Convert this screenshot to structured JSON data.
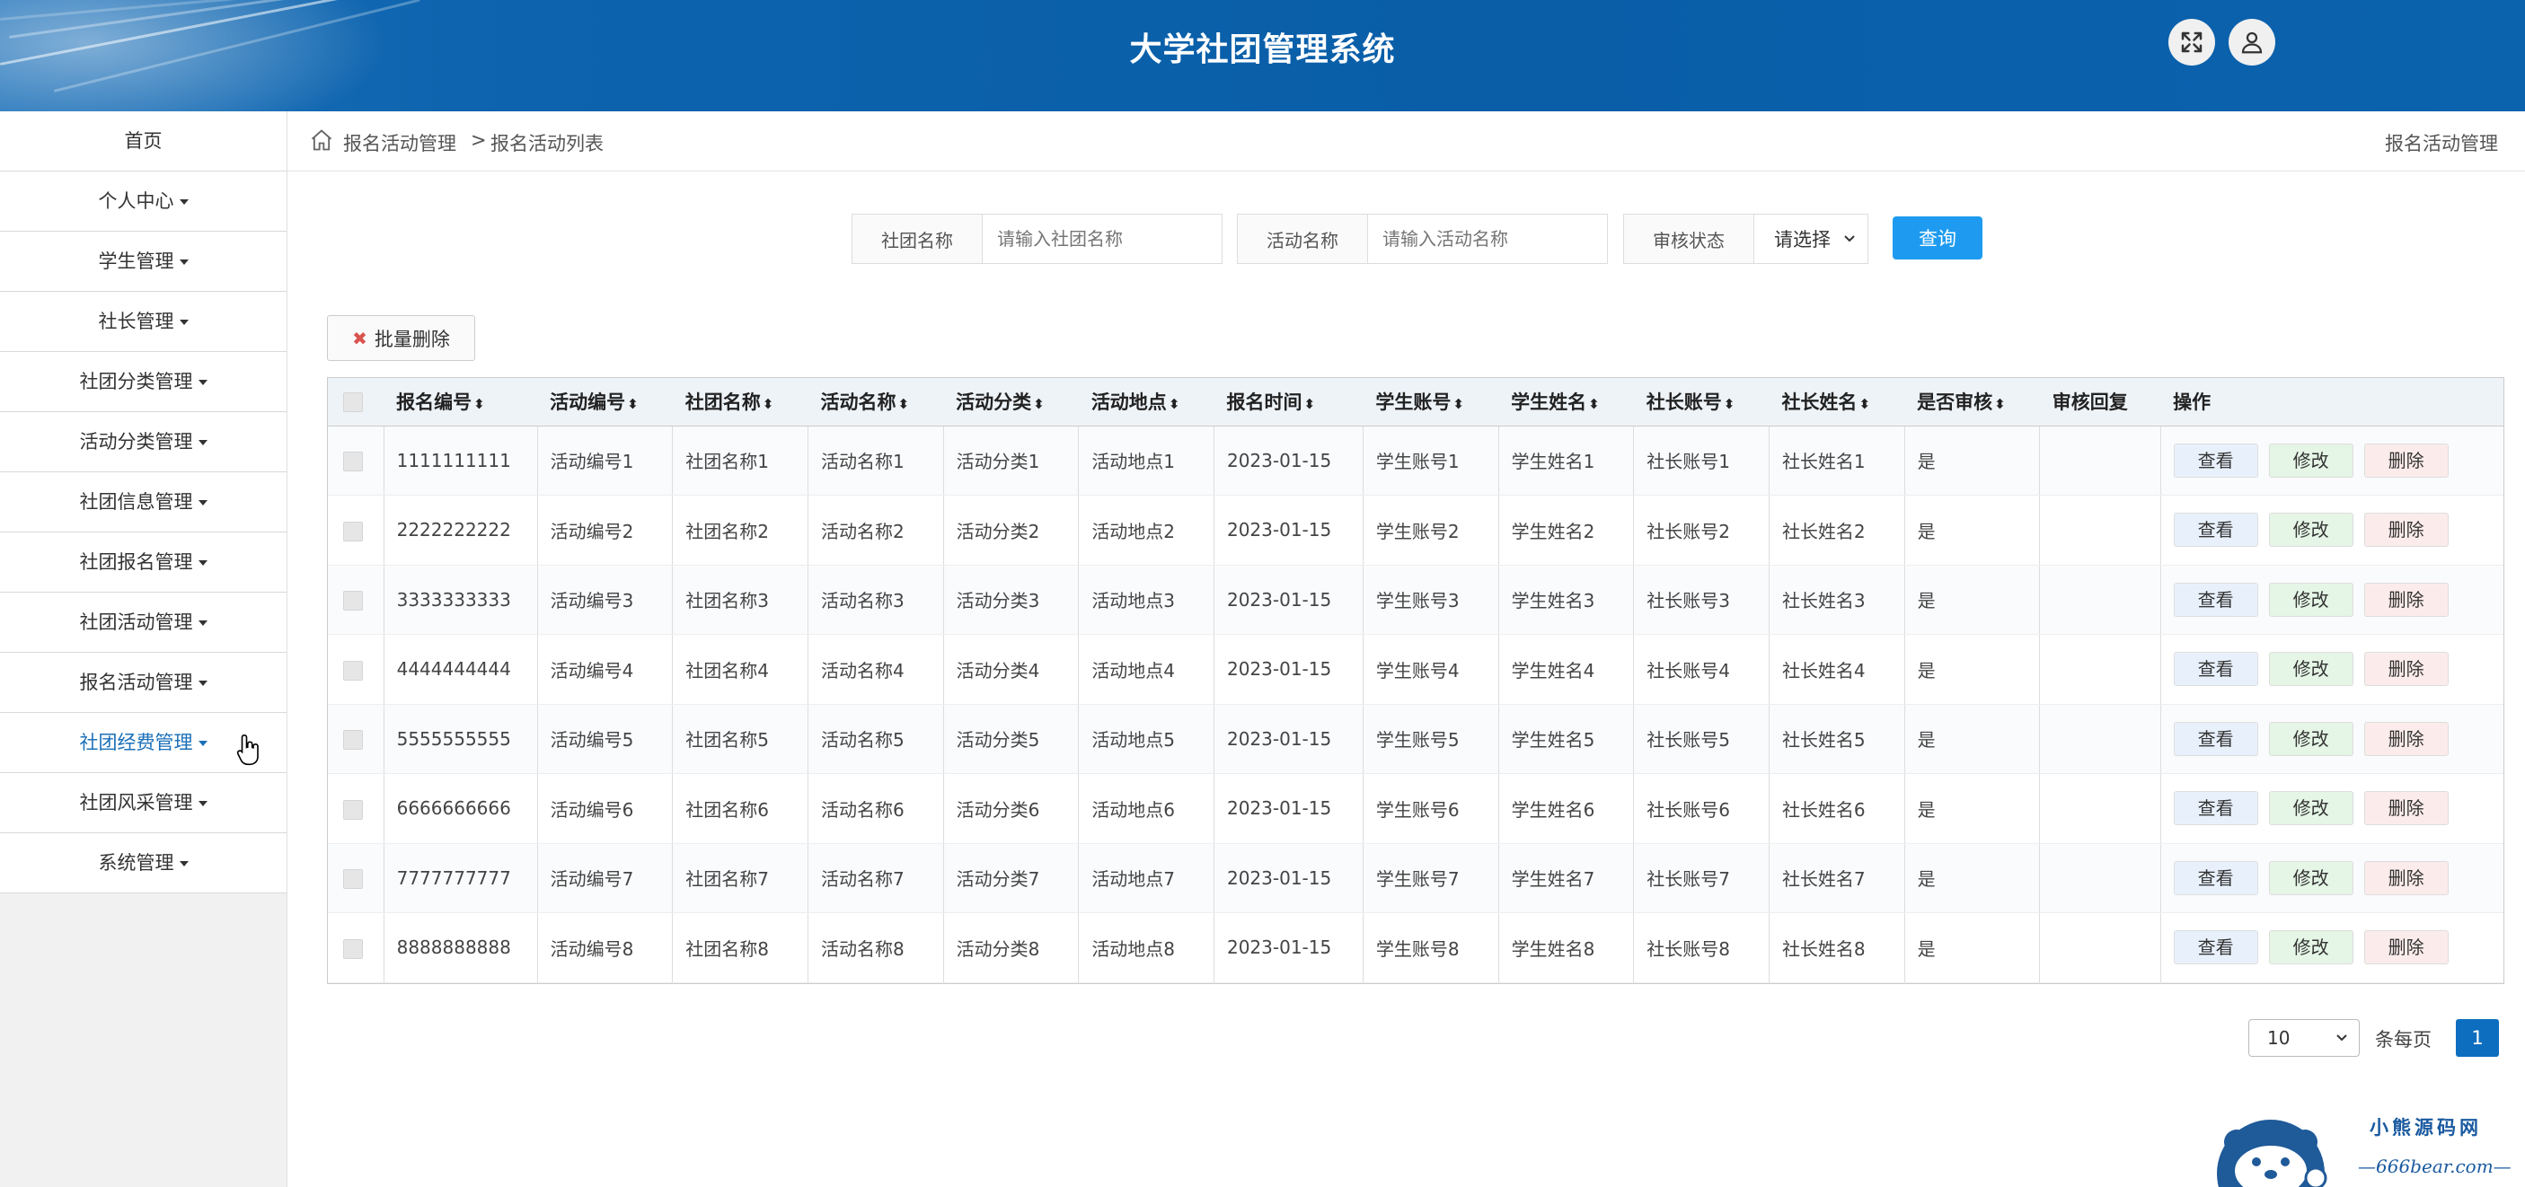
{
  "header": {
    "title": "大学社团管理系统"
  },
  "sidebar": {
    "items": [
      {
        "label": "首页",
        "has_caret": false
      },
      {
        "label": "个人中心",
        "has_caret": true
      },
      {
        "label": "学生管理",
        "has_caret": true
      },
      {
        "label": "社长管理",
        "has_caret": true
      },
      {
        "label": "社团分类管理",
        "has_caret": true
      },
      {
        "label": "活动分类管理",
        "has_caret": true
      },
      {
        "label": "社团信息管理",
        "has_caret": true
      },
      {
        "label": "社团报名管理",
        "has_caret": true
      },
      {
        "label": "社团活动管理",
        "has_caret": true
      },
      {
        "label": "报名活动管理",
        "has_caret": true
      },
      {
        "label": "社团经费管理",
        "has_caret": true,
        "active": true
      },
      {
        "label": "社团风采管理",
        "has_caret": true
      },
      {
        "label": "系统管理",
        "has_caret": true
      }
    ]
  },
  "breadcrumb": {
    "level1": "报名活动管理",
    "separator": ">",
    "level2": "报名活动列表",
    "right_title": "报名活动管理"
  },
  "search": {
    "club_label": "社团名称",
    "club_placeholder": "请输入社团名称",
    "activity_label": "活动名称",
    "activity_placeholder": "请输入活动名称",
    "status_label": "审核状态",
    "status_selected": "请选择",
    "query_label": "查询"
  },
  "toolbar": {
    "batch_delete_label": "批量删除"
  },
  "table": {
    "columns": [
      "报名编号",
      "活动编号",
      "社团名称",
      "活动名称",
      "活动分类",
      "活动地点",
      "报名时间",
      "学生账号",
      "学生姓名",
      "社长账号",
      "社长姓名",
      "是否审核",
      "审核回复",
      "操作"
    ],
    "sortable": [
      true,
      true,
      true,
      true,
      true,
      true,
      true,
      true,
      true,
      true,
      true,
      true,
      false,
      false
    ],
    "actions": {
      "view": "查看",
      "edit": "修改",
      "delete": "删除"
    },
    "rows": [
      [
        "1111111111",
        "活动编号1",
        "社团名称1",
        "活动名称1",
        "活动分类1",
        "活动地点1",
        "2023-01-15",
        "学生账号1",
        "学生姓名1",
        "社长账号1",
        "社长姓名1",
        "是",
        ""
      ],
      [
        "2222222222",
        "活动编号2",
        "社团名称2",
        "活动名称2",
        "活动分类2",
        "活动地点2",
        "2023-01-15",
        "学生账号2",
        "学生姓名2",
        "社长账号2",
        "社长姓名2",
        "是",
        ""
      ],
      [
        "3333333333",
        "活动编号3",
        "社团名称3",
        "活动名称3",
        "活动分类3",
        "活动地点3",
        "2023-01-15",
        "学生账号3",
        "学生姓名3",
        "社长账号3",
        "社长姓名3",
        "是",
        ""
      ],
      [
        "4444444444",
        "活动编号4",
        "社团名称4",
        "活动名称4",
        "活动分类4",
        "活动地点4",
        "2023-01-15",
        "学生账号4",
        "学生姓名4",
        "社长账号4",
        "社长姓名4",
        "是",
        ""
      ],
      [
        "5555555555",
        "活动编号5",
        "社团名称5",
        "活动名称5",
        "活动分类5",
        "活动地点5",
        "2023-01-15",
        "学生账号5",
        "学生姓名5",
        "社长账号5",
        "社长姓名5",
        "是",
        ""
      ],
      [
        "6666666666",
        "活动编号6",
        "社团名称6",
        "活动名称6",
        "活动分类6",
        "活动地点6",
        "2023-01-15",
        "学生账号6",
        "学生姓名6",
        "社长账号6",
        "社长姓名6",
        "是",
        ""
      ],
      [
        "7777777777",
        "活动编号7",
        "社团名称7",
        "活动名称7",
        "活动分类7",
        "活动地点7",
        "2023-01-15",
        "学生账号7",
        "学生姓名7",
        "社长账号7",
        "社长姓名7",
        "是",
        ""
      ],
      [
        "8888888888",
        "活动编号8",
        "社团名称8",
        "活动名称8",
        "活动分类8",
        "活动地点8",
        "2023-01-15",
        "学生账号8",
        "学生姓名8",
        "社长账号8",
        "社长姓名8",
        "是",
        ""
      ]
    ]
  },
  "pagination": {
    "page_size": "10",
    "per_page_label": "条每页",
    "current_page": "1"
  },
  "watermark": {
    "line1": "小熊源码网",
    "line2": "—666bear.com—"
  },
  "colors": {
    "header_bg": "#0d63ad",
    "accent": "#1e9bf0",
    "active_page": "#0d6ec0",
    "active_menu": "#1a6fb8"
  },
  "icons": {
    "fullscreen": "expand-arrows-icon",
    "user": "user-icon",
    "home": "home-icon"
  }
}
